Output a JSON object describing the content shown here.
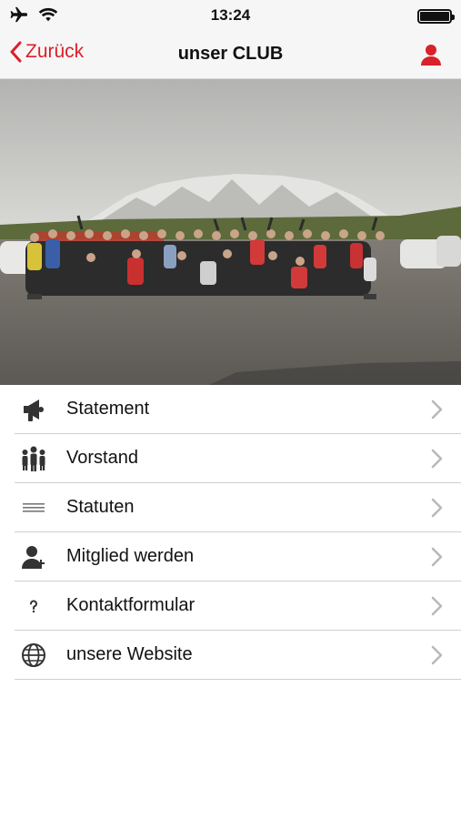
{
  "status_bar": {
    "time": "13:24",
    "icons": [
      "airplane-icon",
      "wifi-icon",
      "battery-icon"
    ]
  },
  "nav": {
    "back_label": "Zurück",
    "title": "unser CLUB",
    "right_icon": "user-icon"
  },
  "hero": {
    "description_icon": "group-photo"
  },
  "menu": {
    "items": [
      {
        "label": "Statement",
        "icon": "megaphone-icon"
      },
      {
        "label": "Vorstand",
        "icon": "group-icon"
      },
      {
        "label": "Statuten",
        "icon": "lines-icon"
      },
      {
        "label": "Mitglied werden",
        "icon": "add-user-icon"
      },
      {
        "label": "Kontaktformular",
        "icon": "question-icon"
      },
      {
        "label": "unsere Website",
        "icon": "globe-icon"
      }
    ]
  },
  "colors": {
    "accent": "#d9212a",
    "bar_background": "#f6f6f6",
    "separator": "#cfcfcf"
  }
}
